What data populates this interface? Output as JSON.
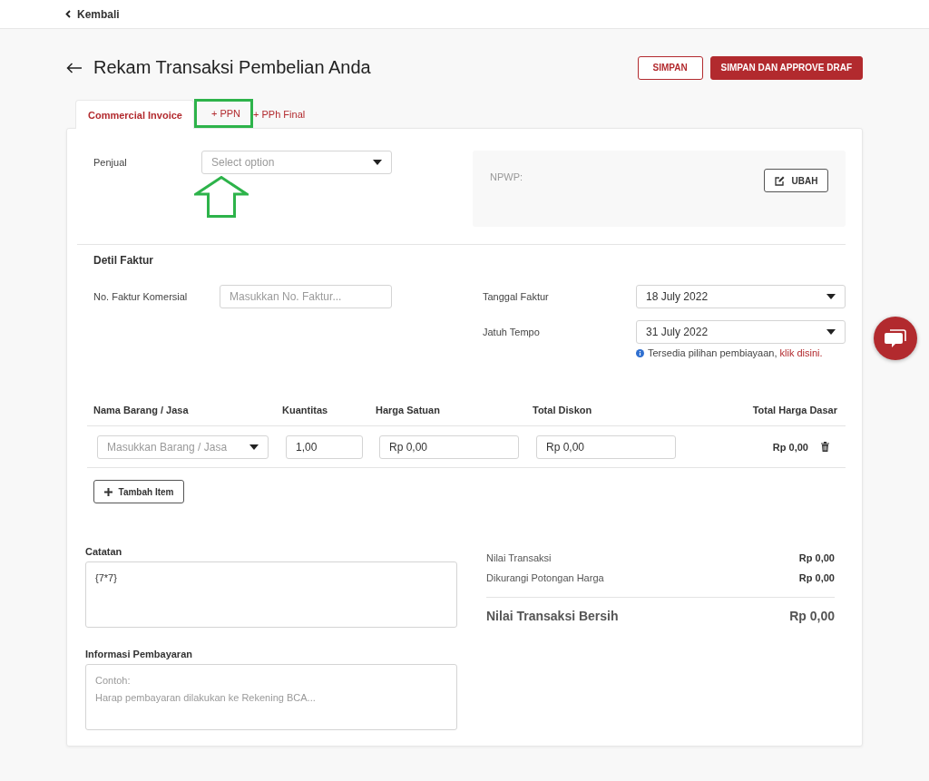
{
  "top_bar": {
    "back_link": "Kembali"
  },
  "page_title": "Rekam Transaksi Pembelian Anda",
  "actions": [
    {
      "label": "SIMPAN",
      "kind": "outline"
    },
    {
      "label": "SIMPAN DAN APPROVE DRAF",
      "kind": "primary"
    }
  ],
  "tabs": [
    {
      "label": "Commercial Invoice",
      "selected": true,
      "highlighted": false
    },
    {
      "label": "+ PPN",
      "selected": false,
      "highlighted": true
    },
    {
      "label": "+ PPh Final",
      "selected": false,
      "highlighted": false
    }
  ],
  "annotation": {
    "kind": "highlight-arrow"
  },
  "seller": {
    "label": "Penjual",
    "placeholder": "Select option"
  },
  "npwp": {
    "label": "NPWP:",
    "button": "UBAH"
  },
  "invoice_details": {
    "heading": "Detil Faktur",
    "invoice_number": {
      "label": "No. Faktur Komersial",
      "placeholder": "Masukkan No. Faktur..."
    },
    "invoice_date": {
      "label": "Tanggal Faktur",
      "value": "18 July 2022"
    },
    "due_date": {
      "label": "Jatuh Tempo",
      "value": "31 July 2022"
    },
    "financing_note": {
      "text": "Tersedia pilihan pembiayaan, ",
      "link": "klik disini."
    }
  },
  "items_table": {
    "columns": [
      "Nama Barang / Jasa",
      "Kuantitas",
      "Harga Satuan",
      "Total Diskon",
      "Total Harga Dasar"
    ],
    "rows": [
      {
        "item_placeholder": "Masukkan Barang / Jasa",
        "quantity": "1,00",
        "unit_price": "Rp 0,00",
        "discount": "Rp 0,00",
        "total": "Rp 0,00"
      }
    ],
    "add_button": "Tambah Item"
  },
  "notes": {
    "label": "Catatan",
    "value": "{7*7}"
  },
  "payment_info": {
    "label": "Informasi Pembayaran",
    "placeholder": "Contoh:\nHarap pembayaran dilakukan ke Rekening BCA..."
  },
  "summary": {
    "lines": [
      {
        "label": "Nilai Transaksi",
        "value": "Rp 0,00"
      },
      {
        "label": "Dikurangi Potongan Harga",
        "value": "Rp 0,00"
      }
    ],
    "net": {
      "label": "Nilai Transaksi Bersih",
      "value": "Rp 0,00"
    }
  }
}
